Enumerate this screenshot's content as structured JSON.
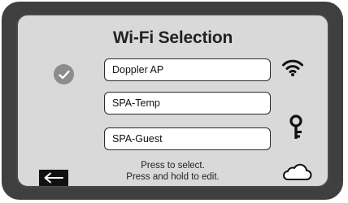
{
  "screen": {
    "title": "Wi-Fi Selection"
  },
  "networks": [
    {
      "name": "Doppler AP",
      "selected": true
    },
    {
      "name": "SPA-Temp",
      "selected": false
    },
    {
      "name": "SPA-Guest",
      "selected": false
    }
  ],
  "icons": {
    "selected": "check-icon",
    "signal": "wifi-icon",
    "security": "key-icon",
    "cloud": "cloud-icon",
    "back": "back-arrow-icon"
  },
  "help": {
    "line1": "Press to select.",
    "line2": "Press and hold to edit."
  },
  "colors": {
    "bezel": "#3f3f3f",
    "screen": "#d9d9d9",
    "field": "#ffffff",
    "check_circle": "#8c8c8c"
  }
}
